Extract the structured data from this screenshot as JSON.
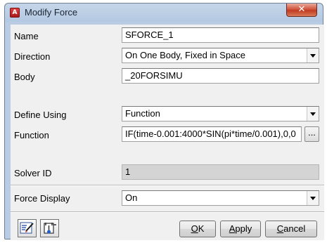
{
  "window": {
    "title": "Modify Force",
    "icon_letter": "A",
    "close_glyph": "✕"
  },
  "form": {
    "name": {
      "label": "Name",
      "value": "SFORCE_1"
    },
    "direction": {
      "label": "Direction",
      "value": "On One Body, Fixed in Space"
    },
    "body": {
      "label": "Body",
      "value": "_20FORSIMU"
    },
    "define_using": {
      "label": "Define Using",
      "value": "Function"
    },
    "function": {
      "label": "Function",
      "value": "IF(time-0.001:4000*SIN(pi*time/0.001),0,0",
      "browse_label": "..."
    },
    "solver_id": {
      "label": "Solver ID",
      "value": "1"
    },
    "force_display": {
      "label": "Force Display",
      "value": "On"
    }
  },
  "buttons": {
    "ok_mnemonic": "O",
    "ok_rest": "K",
    "apply_mnemonic": "A",
    "apply_rest": "pply",
    "cancel_mnemonic": "C",
    "cancel_rest": "ancel"
  },
  "toolbar": {
    "icons": [
      "edit-notes-icon",
      "properties-tool-icon"
    ]
  },
  "colors": {
    "title_bar": "#b9cce3",
    "close_button": "#c13b22",
    "dialog_background": "#f0f0f0",
    "disabled_field": "#d4d4d4"
  }
}
